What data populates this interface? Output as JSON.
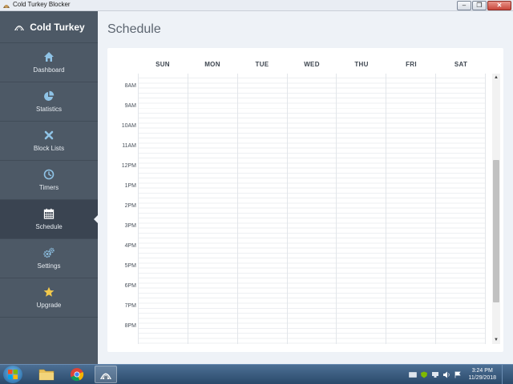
{
  "window": {
    "title": "Cold Turkey Blocker",
    "minimize_label": "–",
    "maximize_label": "❐",
    "close_label": "✕"
  },
  "sidebar": {
    "brand": "Cold Turkey",
    "active_item": "Schedule",
    "items": [
      {
        "label": "Dashboard",
        "icon": "home-icon"
      },
      {
        "label": "Statistics",
        "icon": "pie-chart-icon"
      },
      {
        "label": "Block Lists",
        "icon": "x-icon"
      },
      {
        "label": "Timers",
        "icon": "clock-icon"
      },
      {
        "label": "Schedule",
        "icon": "calendar-icon"
      },
      {
        "label": "Settings",
        "icon": "gears-icon"
      },
      {
        "label": "Upgrade",
        "icon": "star-icon"
      }
    ]
  },
  "main": {
    "title": "Schedule",
    "days": [
      "SUN",
      "MON",
      "TUE",
      "WED",
      "THU",
      "FRI",
      "SAT"
    ],
    "hours": [
      "8AM",
      "9AM",
      "10AM",
      "11AM",
      "12PM",
      "1PM",
      "2PM",
      "3PM",
      "4PM",
      "5PM",
      "6PM",
      "7PM",
      "8PM"
    ]
  },
  "scrollbar": {
    "up_arrow": "▲",
    "down_arrow": "▼"
  },
  "taskbar": {
    "time": "3:24 PM",
    "date": "11/29/2018"
  },
  "colors": {
    "sidebar_bg": "#4d5966",
    "sidebar_active": "#3a4451",
    "icon_blue": "#8fc3e6",
    "star_yellow": "#f2c94c",
    "main_bg": "#eef2f7"
  }
}
